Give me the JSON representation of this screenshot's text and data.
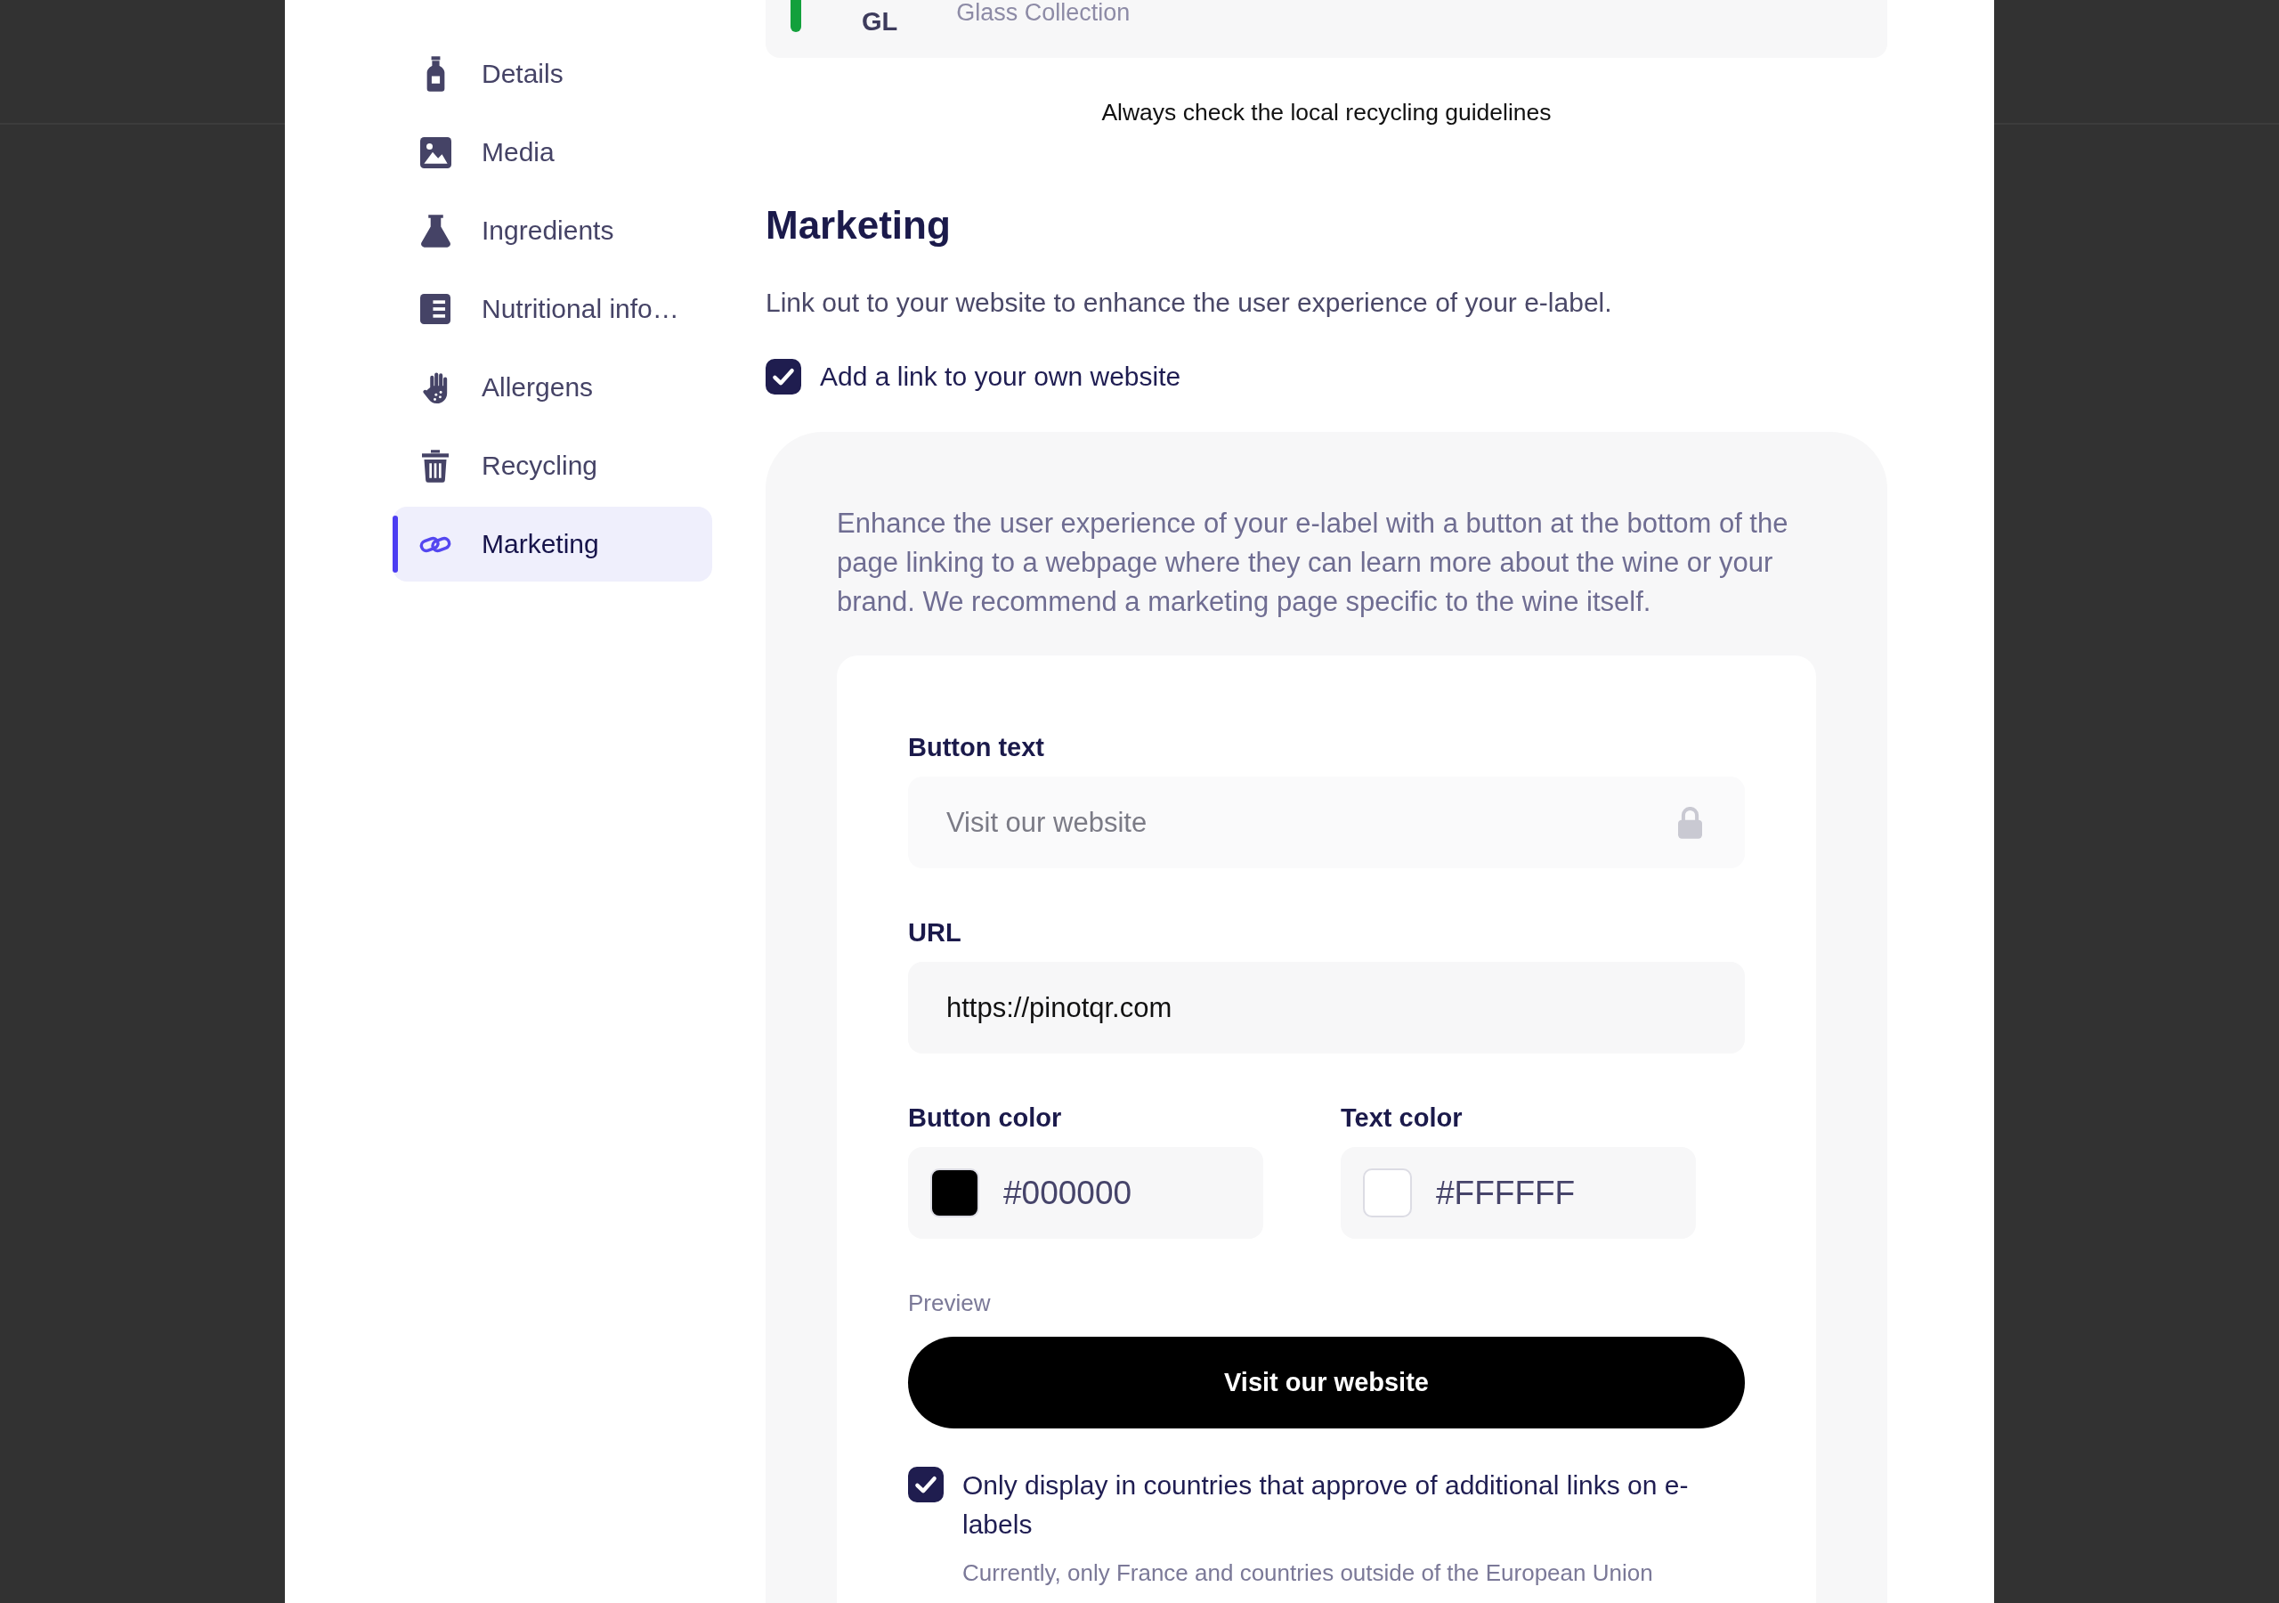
{
  "sidebar": {
    "items": [
      {
        "label": "Details",
        "selected": false
      },
      {
        "label": "Media",
        "selected": false
      },
      {
        "label": "Ingredients",
        "selected": false
      },
      {
        "label": "Nutritional info…",
        "selected": false
      },
      {
        "label": "Allergens",
        "selected": false
      },
      {
        "label": "Recycling",
        "selected": false
      },
      {
        "label": "Marketing",
        "selected": true
      }
    ]
  },
  "recycling": {
    "items": [
      {
        "code": "GL",
        "name": "Glass Collection",
        "color": "#13a03c"
      }
    ],
    "note": "Always check the local recycling guidelines"
  },
  "marketing": {
    "title": "Marketing",
    "subtitle": "Link out to your website to enhance the user experience of your e-label.",
    "add_link": {
      "label": "Add a link to your own website",
      "checked": true
    },
    "description": "Enhance the user experience of your e-label with a button at the bottom of the page linking to a webpage where they can learn more about the wine or your brand. We recommend a marketing page specific to the wine itself.",
    "fields": [
      {
        "label": "Button text",
        "value": "Visit our website",
        "locked": true
      },
      {
        "label": "URL",
        "value": "https://pinotqr.com",
        "locked": false
      }
    ],
    "colors": [
      {
        "label": "Button color",
        "value": "#000000",
        "color": "#000000"
      },
      {
        "label": "Text color",
        "value": "#FFFFFF",
        "color": "#ffffff"
      }
    ],
    "preview": {
      "label": "Preview",
      "button": "Visit our website"
    },
    "restrict": {
      "label": "Only display in countries that approve of additional links on e-labels",
      "checked": true,
      "note": "Currently, only France and countries outside of the European Union"
    }
  }
}
